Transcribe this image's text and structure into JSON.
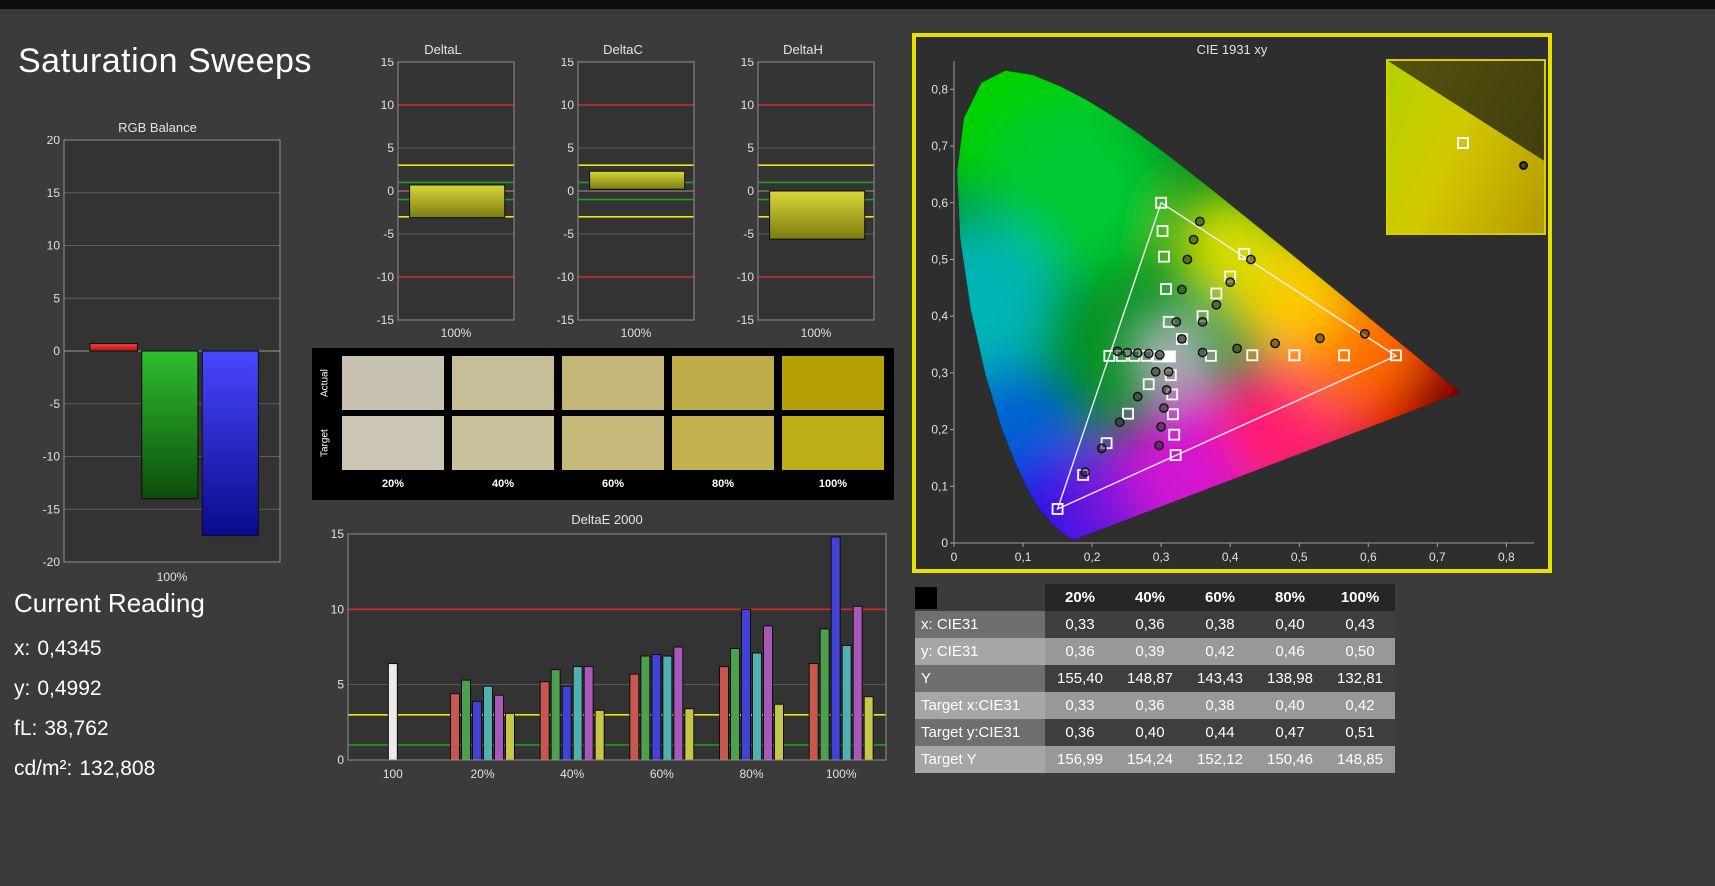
{
  "page": {
    "title": "Saturation Sweeps"
  },
  "current_reading": {
    "title": "Current Reading",
    "lines": [
      {
        "label": "x:",
        "value": "0,4345"
      },
      {
        "label": "y:",
        "value": "0,4992"
      },
      {
        "label": "fL:",
        "value": "38,762"
      },
      {
        "label": "cd/m²:",
        "value": "132,808"
      }
    ]
  },
  "chart_data": [
    {
      "id": "rgb_balance",
      "type": "bar",
      "title": "RGB Balance",
      "ylim": [
        -20,
        20
      ],
      "yticks": [
        20,
        15,
        10,
        5,
        0,
        -5,
        -10,
        -15,
        -20
      ],
      "xlabel": "100%",
      "categories": [
        "Red",
        "Green",
        "Blue"
      ],
      "values": [
        0.7,
        -14.0,
        -17.5
      ],
      "colors": [
        "#e02020",
        "#1fa01f",
        "#2828e8"
      ]
    },
    {
      "id": "deltaL",
      "type": "bar",
      "title": "DeltaL",
      "ylim": [
        -15,
        15
      ],
      "yticks": [
        15,
        10,
        5,
        0,
        -5,
        -10,
        -15
      ],
      "xlabel": "100%",
      "categories": [
        "100%"
      ],
      "values": [
        -3.1
      ],
      "bar_span": [
        0.7,
        -3.1
      ],
      "ref_lines": [
        {
          "value": 10,
          "color": "#d42a2a"
        },
        {
          "value": 3,
          "color": "#e8e810"
        },
        {
          "value": 1,
          "color": "#1ea01e"
        },
        {
          "value": -1,
          "color": "#1ea01e"
        },
        {
          "value": -3,
          "color": "#e8e810"
        },
        {
          "value": -10,
          "color": "#d42a2a"
        }
      ]
    },
    {
      "id": "deltaC",
      "type": "bar",
      "title": "DeltaC",
      "ylim": [
        -15,
        15
      ],
      "yticks": [
        15,
        10,
        5,
        0,
        -5,
        -10,
        -15
      ],
      "xlabel": "100%",
      "categories": [
        "100%"
      ],
      "values": [
        2.3
      ],
      "bar_span": [
        2.3,
        0.2
      ],
      "ref_lines": [
        {
          "value": 10,
          "color": "#d42a2a"
        },
        {
          "value": 3,
          "color": "#e8e810"
        },
        {
          "value": 1,
          "color": "#1ea01e"
        },
        {
          "value": -1,
          "color": "#1ea01e"
        },
        {
          "value": -3,
          "color": "#e8e810"
        },
        {
          "value": -10,
          "color": "#d42a2a"
        }
      ]
    },
    {
      "id": "deltaH",
      "type": "bar",
      "title": "DeltaH",
      "ylim": [
        -15,
        15
      ],
      "yticks": [
        15,
        10,
        5,
        0,
        -5,
        -10,
        -15
      ],
      "xlabel": "100%",
      "categories": [
        "100%"
      ],
      "values": [
        -5.6
      ],
      "bar_span": [
        0.0,
        -5.6
      ],
      "ref_lines": [
        {
          "value": 10,
          "color": "#d42a2a"
        },
        {
          "value": 3,
          "color": "#e8e810"
        },
        {
          "value": 1,
          "color": "#1ea01e"
        },
        {
          "value": -1,
          "color": "#1ea01e"
        },
        {
          "value": -3,
          "color": "#e8e810"
        },
        {
          "value": -10,
          "color": "#d42a2a"
        }
      ]
    },
    {
      "id": "saturation_swatches",
      "type": "swatches",
      "row_labels": [
        "Actual",
        "Target"
      ],
      "col_labels": [
        "20%",
        "40%",
        "60%",
        "80%",
        "100%"
      ],
      "actual_colors": [
        "#c9c2b1",
        "#c7bd98",
        "#c3b676",
        "#beab4a",
        "#b5a007"
      ],
      "target_colors": [
        "#cbc5b3",
        "#c9c09c",
        "#c5ba7a",
        "#c1b24e",
        "#bdae16"
      ]
    },
    {
      "id": "deltaE2000",
      "type": "bar",
      "title": "DeltaE 2000",
      "ylim": [
        0,
        15
      ],
      "yticks": [
        15,
        10,
        5,
        0
      ],
      "group_labels": [
        "100",
        "20%",
        "40%",
        "60%",
        "80%",
        "100%"
      ],
      "series_colors": {
        "white": "#ececec",
        "red": "#c65850",
        "green": "#4da04d",
        "blue": "#4242d6",
        "cyan": "#52b0b0",
        "magenta": "#a858b8",
        "yellow": "#c6c648"
      },
      "groups": [
        {
          "label": "100",
          "bars": [
            {
              "series": "white",
              "value": 6.4
            }
          ]
        },
        {
          "label": "20%",
          "bars": [
            {
              "series": "red",
              "value": 4.4
            },
            {
              "series": "green",
              "value": 5.3
            },
            {
              "series": "blue",
              "value": 3.9
            },
            {
              "series": "cyan",
              "value": 4.9
            },
            {
              "series": "magenta",
              "value": 4.3
            },
            {
              "series": "yellow",
              "value": 3.1
            }
          ]
        },
        {
          "label": "40%",
          "bars": [
            {
              "series": "red",
              "value": 5.2
            },
            {
              "series": "green",
              "value": 6.0
            },
            {
              "series": "blue",
              "value": 4.9
            },
            {
              "series": "cyan",
              "value": 6.2
            },
            {
              "series": "magenta",
              "value": 6.2
            },
            {
              "series": "yellow",
              "value": 3.3
            }
          ]
        },
        {
          "label": "60%",
          "bars": [
            {
              "series": "red",
              "value": 5.7
            },
            {
              "series": "green",
              "value": 6.9
            },
            {
              "series": "blue",
              "value": 7.0
            },
            {
              "series": "cyan",
              "value": 6.9
            },
            {
              "series": "magenta",
              "value": 7.5
            },
            {
              "series": "yellow",
              "value": 3.4
            }
          ]
        },
        {
          "label": "80%",
          "bars": [
            {
              "series": "red",
              "value": 6.2
            },
            {
              "series": "green",
              "value": 7.4
            },
            {
              "series": "blue",
              "value": 10.0
            },
            {
              "series": "cyan",
              "value": 7.1
            },
            {
              "series": "magenta",
              "value": 8.9
            },
            {
              "series": "yellow",
              "value": 3.7
            }
          ]
        },
        {
          "label": "100%",
          "bars": [
            {
              "series": "red",
              "value": 6.4
            },
            {
              "series": "green",
              "value": 8.7
            },
            {
              "series": "blue",
              "value": 14.8
            },
            {
              "series": "cyan",
              "value": 7.6
            },
            {
              "series": "magenta",
              "value": 10.2
            },
            {
              "series": "yellow",
              "value": 4.2
            }
          ]
        }
      ],
      "ref_lines": [
        {
          "value": 10,
          "color": "#d42a2a"
        },
        {
          "value": 3,
          "color": "#e8e810"
        },
        {
          "value": 1,
          "color": "#1ea01e"
        }
      ]
    },
    {
      "id": "cie1931",
      "type": "scatter",
      "title": "CIE 1931 xy",
      "xticks": [
        "0",
        "0,1",
        "0,2",
        "0,3",
        "0,4",
        "0,5",
        "0,6",
        "0,7",
        "0,8"
      ],
      "yticks": [
        "0",
        "0,1",
        "0,2",
        "0,3",
        "0,4",
        "0,5",
        "0,6",
        "0,7",
        "0,8"
      ],
      "gamut_triangle": [
        [
          0.64,
          0.33
        ],
        [
          0.3,
          0.6
        ],
        [
          0.15,
          0.06
        ]
      ],
      "white_point": [
        0.3127,
        0.329
      ],
      "targets": {
        "red": [
          [
            0.372,
            0.33
          ],
          [
            0.432,
            0.331
          ],
          [
            0.493,
            0.331
          ],
          [
            0.565,
            0.331
          ],
          [
            0.64,
            0.331
          ]
        ],
        "green": [
          [
            0.311,
            0.39
          ],
          [
            0.307,
            0.448
          ],
          [
            0.304,
            0.505
          ],
          [
            0.302,
            0.55
          ],
          [
            0.3,
            0.6
          ]
        ],
        "blue": [
          [
            0.282,
            0.28
          ],
          [
            0.252,
            0.228
          ],
          [
            0.221,
            0.176
          ],
          [
            0.187,
            0.12
          ],
          [
            0.15,
            0.06
          ]
        ],
        "cyan": [
          [
            0.296,
            0.329
          ],
          [
            0.279,
            0.33
          ],
          [
            0.261,
            0.33
          ],
          [
            0.243,
            0.33
          ],
          [
            0.225,
            0.33
          ]
        ],
        "magenta": [
          [
            0.314,
            0.296
          ],
          [
            0.316,
            0.262
          ],
          [
            0.317,
            0.227
          ],
          [
            0.319,
            0.191
          ],
          [
            0.321,
            0.155
          ]
        ],
        "yellow": [
          [
            0.33,
            0.36
          ],
          [
            0.36,
            0.4
          ],
          [
            0.38,
            0.44
          ],
          [
            0.4,
            0.47
          ],
          [
            0.42,
            0.51
          ]
        ]
      },
      "measurements": {
        "red": [
          [
            0.36,
            0.336
          ],
          [
            0.41,
            0.343
          ],
          [
            0.465,
            0.352
          ],
          [
            0.53,
            0.361
          ],
          [
            0.595,
            0.369
          ]
        ],
        "green": [
          [
            0.322,
            0.39
          ],
          [
            0.33,
            0.447
          ],
          [
            0.338,
            0.5
          ],
          [
            0.347,
            0.535
          ],
          [
            0.356,
            0.567
          ]
        ],
        "blue": [
          [
            0.292,
            0.302
          ],
          [
            0.266,
            0.258
          ],
          [
            0.24,
            0.213
          ],
          [
            0.214,
            0.167
          ],
          [
            0.19,
            0.125
          ]
        ],
        "cyan": [
          [
            0.298,
            0.332
          ],
          [
            0.282,
            0.334
          ],
          [
            0.266,
            0.335
          ],
          [
            0.251,
            0.336
          ],
          [
            0.237,
            0.338
          ]
        ],
        "magenta": [
          [
            0.311,
            0.302
          ],
          [
            0.308,
            0.27
          ],
          [
            0.304,
            0.238
          ],
          [
            0.3,
            0.205
          ],
          [
            0.297,
            0.172
          ]
        ],
        "yellow": [
          [
            0.33,
            0.36
          ],
          [
            0.36,
            0.39
          ],
          [
            0.38,
            0.42
          ],
          [
            0.4,
            0.46
          ],
          [
            0.43,
            0.5
          ]
        ]
      }
    },
    {
      "id": "saturation_table",
      "type": "table",
      "columns": [
        "20%",
        "40%",
        "60%",
        "80%",
        "100%"
      ],
      "rows": [
        {
          "label": "x: CIE31",
          "values": [
            "0,33",
            "0,36",
            "0,38",
            "0,40",
            "0,43"
          ]
        },
        {
          "label": "y: CIE31",
          "values": [
            "0,36",
            "0,39",
            "0,42",
            "0,46",
            "0,50"
          ]
        },
        {
          "label": "Y",
          "values": [
            "155,40",
            "148,87",
            "143,43",
            "138,98",
            "132,81"
          ]
        },
        {
          "label": "Target x:CIE31",
          "values": [
            "0,33",
            "0,36",
            "0,38",
            "0,40",
            "0,42"
          ]
        },
        {
          "label": "Target y:CIE31",
          "values": [
            "0,36",
            "0,40",
            "0,44",
            "0,47",
            "0,51"
          ]
        },
        {
          "label": "Target Y",
          "values": [
            "156,99",
            "154,24",
            "152,12",
            "150,46",
            "148,85"
          ]
        }
      ]
    }
  ]
}
